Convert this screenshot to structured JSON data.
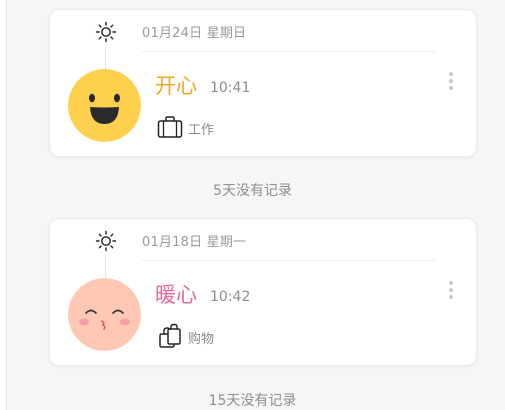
{
  "entries": [
    {
      "date": "01月24日 星期日",
      "mood": "开心",
      "mood_color": "#f5a623",
      "time": "10:41",
      "activity": "工作",
      "activity_icon": "briefcase-icon",
      "face_color": "#ffd04d",
      "weather_icon": "sun-icon"
    },
    {
      "date": "01月18日 星期一",
      "mood": "暖心",
      "mood_color": "#e8679e",
      "time": "10:42",
      "activity": "购物",
      "activity_icon": "shopping-bag-icon",
      "face_color": "#ffc8b4",
      "weather_icon": "sun-icon"
    }
  ],
  "gaps": [
    "5天没有记录",
    "15天没有记录"
  ]
}
